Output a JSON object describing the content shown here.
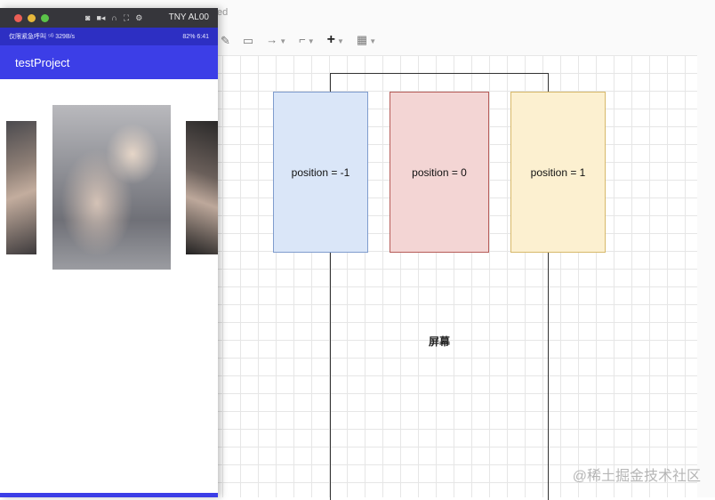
{
  "editor": {
    "title_fragment": "ed",
    "toolbar": [
      {
        "name": "pencil-icon",
        "glyph": "✎"
      },
      {
        "name": "shape-icon",
        "glyph": "▭"
      },
      {
        "name": "connector-arrow-icon",
        "glyph": "→"
      },
      {
        "name": "waypoint-icon",
        "glyph": "⌐"
      },
      {
        "name": "insert-plus-icon",
        "glyph": "+"
      },
      {
        "name": "table-icon",
        "glyph": "▦"
      }
    ],
    "screen_label": "屏幕",
    "cards": [
      {
        "label": "position = -1",
        "fill": "#dae6f8",
        "stroke": "#7f9ccd"
      },
      {
        "label": "position = 0",
        "fill": "#f3d5d4",
        "stroke": "#b65c58"
      },
      {
        "label": "position = 1",
        "fill": "#fcf0d0",
        "stroke": "#d7b86a"
      }
    ],
    "watermark": "@稀土掘金技术社区"
  },
  "emulator": {
    "device_name": "TNY AL00",
    "status_left": "仅限紧急呼叫 ⁵ᴳ 329B/s",
    "status_right": "82% 6:41",
    "app_title": "testProject",
    "colors": {
      "appbar": "#3c3ee7",
      "statusbar": "#2d2fc3"
    }
  }
}
